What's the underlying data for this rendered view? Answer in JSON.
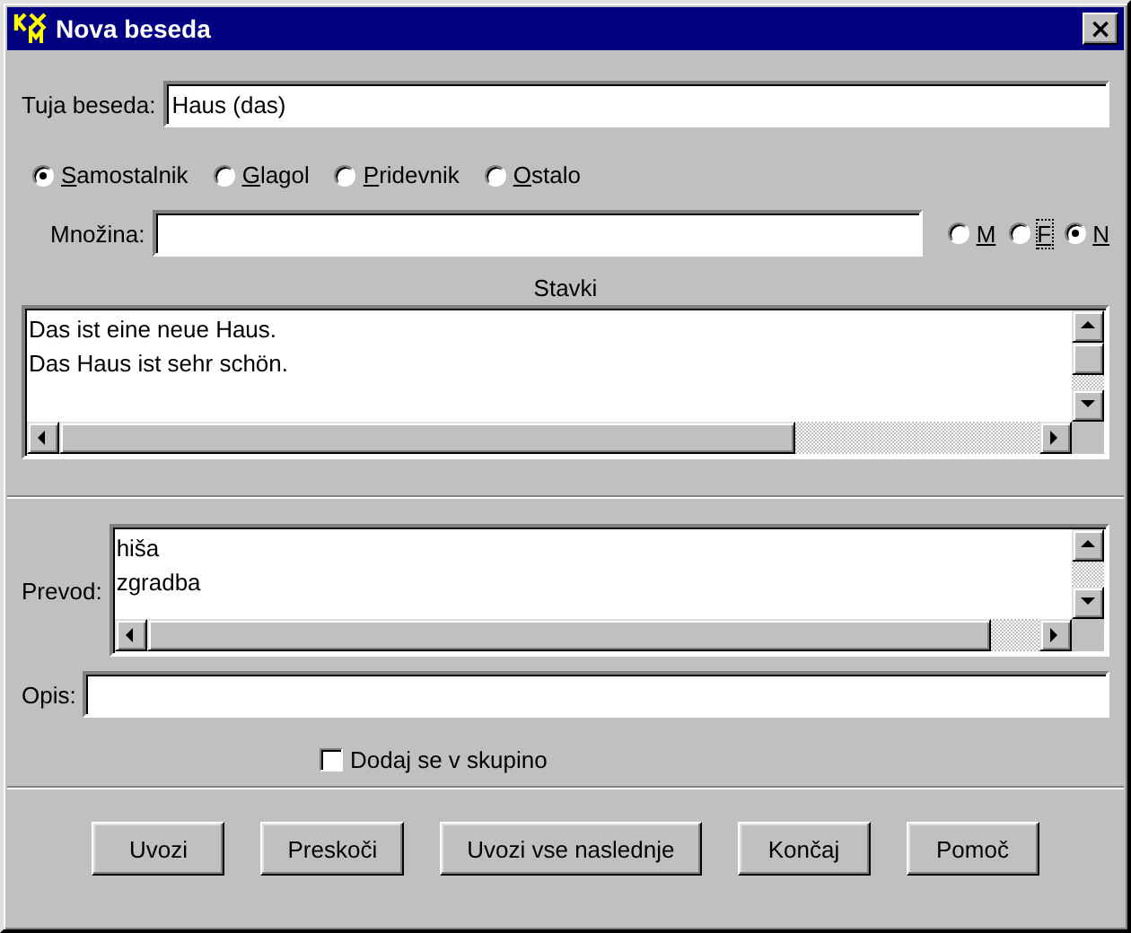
{
  "window": {
    "title": "Nova beseda",
    "close": "×"
  },
  "foreign_word": {
    "label": "Tuja beseda:",
    "value": "Haus (das)"
  },
  "word_types": [
    {
      "label": "Samostalnik",
      "selected": true
    },
    {
      "label": "Glagol",
      "selected": false
    },
    {
      "label": "Pridevnik",
      "selected": false
    },
    {
      "label": "Ostalo",
      "selected": false
    }
  ],
  "plural": {
    "label": "Množina:"
  },
  "genders": [
    {
      "label": "M",
      "selected": false,
      "focused": false
    },
    {
      "label": "F",
      "selected": false,
      "focused": true
    },
    {
      "label": "N",
      "selected": true,
      "focused": false
    }
  ],
  "sentences": {
    "label": "Stavki",
    "lines": [
      "Das ist eine neue Haus.",
      "Das Haus ist sehr schön."
    ]
  },
  "translation": {
    "label": "Prevod:",
    "lines": [
      "hiša",
      "zgradba"
    ]
  },
  "description": {
    "label": "Opis:"
  },
  "add_to_group": {
    "label": "Dodaj se v skupino",
    "checked": false
  },
  "buttons": [
    "Uvozi",
    "Preskoči",
    "Uvozi vse naslednje",
    "Končaj",
    "Pomoč"
  ]
}
